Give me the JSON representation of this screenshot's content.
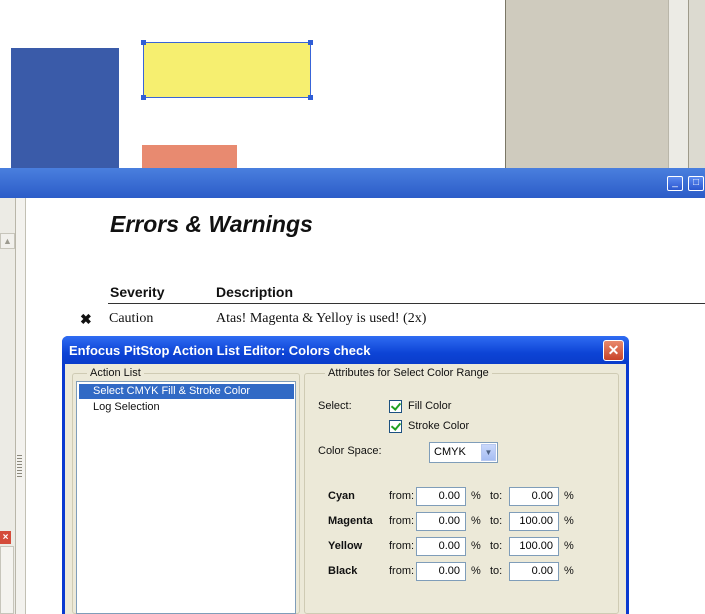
{
  "report": {
    "title": "Errors & Warnings",
    "columns": [
      "Severity",
      "Description"
    ],
    "rows": [
      {
        "severity_icon": "x-mark-icon",
        "severity": "Caution",
        "description": "Atas! Magenta & Yelloy is used! (2x)"
      }
    ]
  },
  "dialog": {
    "title": "Enfocus PitStop Action List Editor: Colors check",
    "action_list": {
      "legend": "Action List",
      "items": [
        "Select CMYK Fill & Stroke Color",
        "Log Selection"
      ],
      "selected_index": 0
    },
    "attributes": {
      "legend": "Attributes for Select Color Range",
      "select_label": "Select:",
      "fill_color_label": "Fill Color",
      "fill_color_checked": true,
      "stroke_color_label": "Stroke Color",
      "stroke_color_checked": true,
      "color_space_label": "Color Space:",
      "color_space_value": "CMYK",
      "channels": [
        {
          "name": "Cyan",
          "from_label": "from:",
          "from": "0.00",
          "pct1": "%",
          "to_label": "to:",
          "to": "0.00",
          "pct2": "%"
        },
        {
          "name": "Magenta",
          "from_label": "from:",
          "from": "0.00",
          "pct1": "%",
          "to_label": "to:",
          "to": "100.00",
          "pct2": "%"
        },
        {
          "name": "Yellow",
          "from_label": "from:",
          "from": "0.00",
          "pct1": "%",
          "to_label": "to:",
          "to": "100.00",
          "pct2": "%"
        },
        {
          "name": "Black",
          "from_label": "from:",
          "from": "0.00",
          "pct1": "%",
          "to_label": "to:",
          "to": "0.00",
          "pct2": "%"
        }
      ]
    }
  },
  "colors": {
    "xp_blue": "#0a3ad0",
    "selection": "#316ac5",
    "shape_blue": "#3a5ba9",
    "shape_yellow": "#f6ef70",
    "shape_salmon": "#e88a70"
  }
}
